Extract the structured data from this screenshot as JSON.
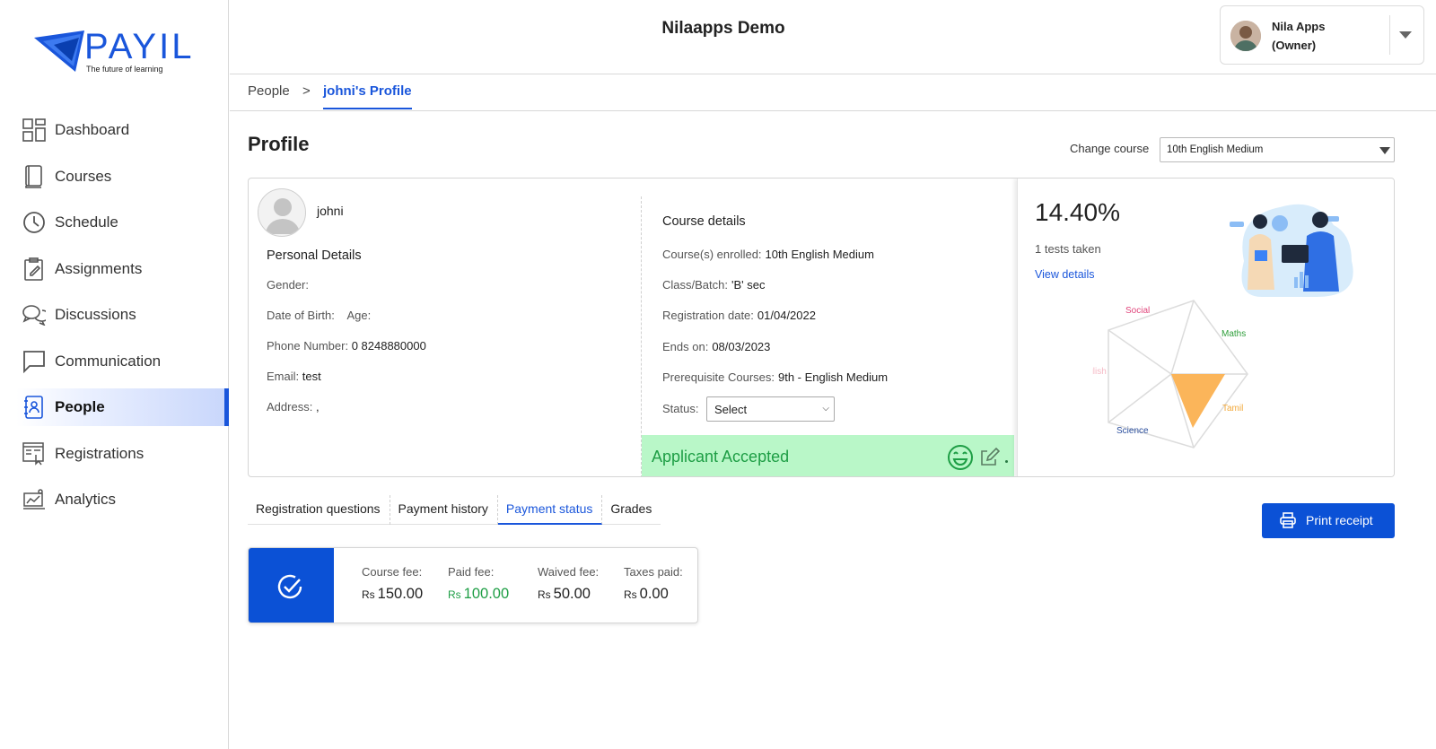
{
  "brand": {
    "name": "PAYIL",
    "tagline": "The future of learning"
  },
  "sidebar": {
    "items": [
      {
        "label": "Dashboard",
        "icon": "dashboard-icon"
      },
      {
        "label": "Courses",
        "icon": "book-icon"
      },
      {
        "label": "Schedule",
        "icon": "clock-icon"
      },
      {
        "label": "Assignments",
        "icon": "clipboard-icon"
      },
      {
        "label": "Discussions",
        "icon": "chat-bubbles-icon"
      },
      {
        "label": "Communication",
        "icon": "message-icon"
      },
      {
        "label": "People",
        "icon": "contacts-book-icon",
        "active": true
      },
      {
        "label": "Registrations",
        "icon": "registration-form-icon"
      },
      {
        "label": "Analytics",
        "icon": "analytics-icon"
      }
    ]
  },
  "header": {
    "title": "Nilaapps Demo",
    "user": {
      "name": "Nila Apps",
      "role": "(Owner)"
    }
  },
  "breadcrumb": {
    "root": "People",
    "separator": ">",
    "current": "johni's Profile"
  },
  "profile": {
    "title": "Profile",
    "change_course_label": "Change course",
    "selected_course": "10th English Medium",
    "student_name": "johni",
    "personal_details_title": "Personal Details",
    "gender_label": "Gender:",
    "gender_value": "",
    "dob_label": "Date of Birth:",
    "age_label": "Age:",
    "phone_label": "Phone Number:",
    "phone_value": "0 8248880000",
    "email_label": "Email:",
    "email_value": "test",
    "address_label": "Address:",
    "address_value": ",",
    "course_details_title": "Course details",
    "courses_enrolled_label": "Course(s) enrolled:",
    "courses_enrolled_value": "10th English Medium",
    "class_label": "Class/Batch:",
    "class_value": "'B' sec",
    "registration_date_label": "Registration date:",
    "registration_date_value": "01/04/2022",
    "ends_on_label": "Ends on:",
    "ends_on_value": "08/03/2023",
    "prerequisite_label": "Prerequisite Courses:",
    "prerequisite_value": "9th - English Medium",
    "status_label": "Status:",
    "status_value": "Select",
    "accepted_text": "Applicant Accepted"
  },
  "stats": {
    "percent": "14.40%",
    "tests_taken": "1 tests taken",
    "view_details": "View details",
    "radar_subjects": [
      "Social",
      "Maths",
      "Tamil",
      "Science",
      "English"
    ],
    "radar_colors": {
      "Social": "#e0457b",
      "Maths": "#2e9e3a",
      "Tamil": "#f2a93b",
      "Science": "#2b4f9e",
      "English": "#f5b8c4"
    },
    "radar_fill": "#fbb55a"
  },
  "tabs": [
    {
      "label": "Registration questions"
    },
    {
      "label": "Payment history"
    },
    {
      "label": "Payment status",
      "active": true
    },
    {
      "label": "Grades"
    }
  ],
  "print_button": "Print receipt",
  "fees": {
    "currency": "Rs",
    "course_fee_label": "Course fee:",
    "course_fee": "150.00",
    "paid_fee_label": "Paid fee:",
    "paid_fee": "100.00",
    "waived_fee_label": "Waived fee:",
    "waived_fee": "50.00",
    "taxes_paid_label": "Taxes paid:",
    "taxes_paid": "0.00"
  },
  "colors": {
    "accent": "#1a56db",
    "button": "#0b51d6",
    "success": "#1e9e45",
    "success_bg": "#b9f7c8"
  }
}
